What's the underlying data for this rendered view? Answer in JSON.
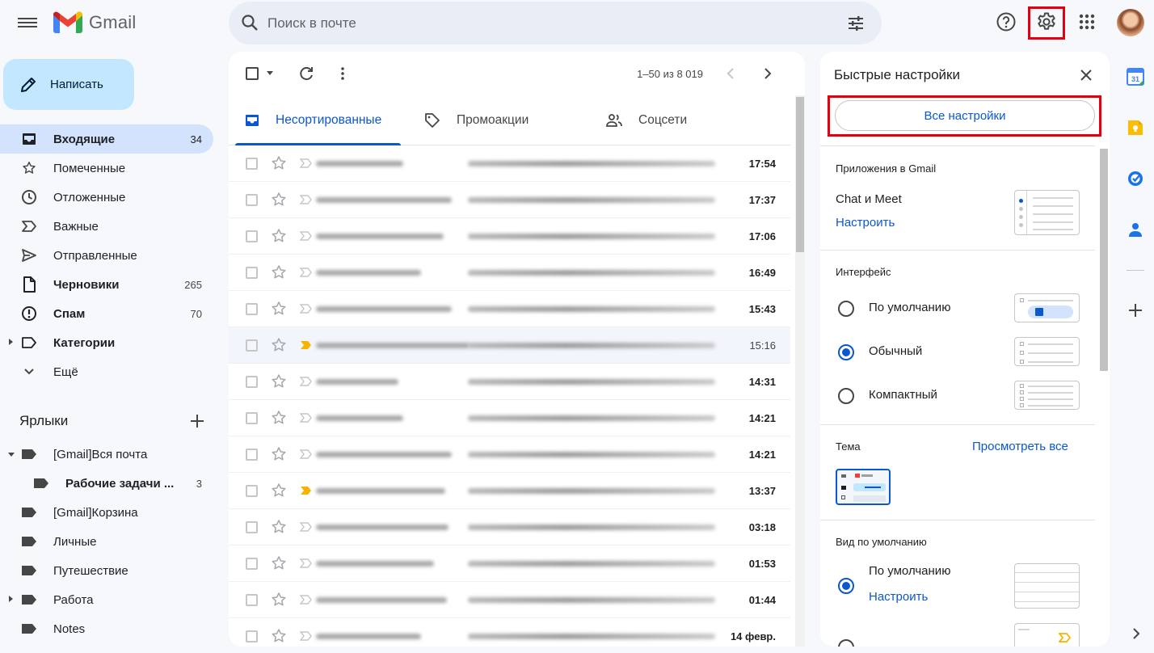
{
  "header": {
    "app_name": "Gmail",
    "search_placeholder": "Поиск в почте"
  },
  "sidebar": {
    "compose_label": "Написать",
    "items": [
      {
        "label": "Входящие",
        "count": "34"
      },
      {
        "label": "Помеченные",
        "count": ""
      },
      {
        "label": "Отложенные",
        "count": ""
      },
      {
        "label": "Важные",
        "count": ""
      },
      {
        "label": "Отправленные",
        "count": ""
      },
      {
        "label": "Черновики",
        "count": "265"
      },
      {
        "label": "Спам",
        "count": "70"
      },
      {
        "label": "Категории",
        "count": ""
      },
      {
        "label": "Ещё",
        "count": ""
      }
    ],
    "labels_title": "Ярлыки",
    "labels": [
      {
        "label": "[Gmail]Вся почта",
        "count": ""
      },
      {
        "label": "Рабочие задачи ...",
        "count": "3"
      },
      {
        "label": "[Gmail]Корзина",
        "count": ""
      },
      {
        "label": "Личные",
        "count": ""
      },
      {
        "label": "Путешествие",
        "count": ""
      },
      {
        "label": "Работа",
        "count": ""
      },
      {
        "label": "Notes",
        "count": ""
      }
    ]
  },
  "toolbar": {
    "pagination": "1–50 из 8 019"
  },
  "tabs": [
    {
      "label": "Несортированные",
      "active": true
    },
    {
      "label": "Промоакции",
      "active": false
    },
    {
      "label": "Соцсети",
      "active": false
    }
  ],
  "emails": [
    {
      "time": "17:54",
      "unread": true,
      "important": false
    },
    {
      "time": "17:37",
      "unread": true,
      "important": false
    },
    {
      "time": "17:06",
      "unread": true,
      "important": false
    },
    {
      "time": "16:49",
      "unread": true,
      "important": false
    },
    {
      "time": "15:43",
      "unread": true,
      "important": false
    },
    {
      "time": "15:16",
      "unread": false,
      "important": true
    },
    {
      "time": "14:31",
      "unread": true,
      "important": false
    },
    {
      "time": "14:21",
      "unread": true,
      "important": false
    },
    {
      "time": "14:21",
      "unread": true,
      "important": false
    },
    {
      "time": "13:37",
      "unread": true,
      "important": true
    },
    {
      "time": "03:18",
      "unread": true,
      "important": false
    },
    {
      "time": "01:53",
      "unread": true,
      "important": false
    },
    {
      "time": "01:44",
      "unread": true,
      "important": false
    },
    {
      "time": "14 февр.",
      "unread": true,
      "important": false
    }
  ],
  "quick_settings": {
    "title": "Быстрые настройки",
    "all_settings": "Все настройки",
    "apps_heading": "Приложения в Gmail",
    "chat_meet": "Chat и Meet",
    "configure": "Настроить",
    "interface_heading": "Интерфейс",
    "density": [
      {
        "label": "По умолчанию",
        "selected": false
      },
      {
        "label": "Обычный",
        "selected": true
      },
      {
        "label": "Компактный",
        "selected": false
      }
    ],
    "theme_heading": "Тема",
    "view_all": "Просмотреть все",
    "inbox_type_heading": "Вид по умолчанию",
    "inbox_default": "По умолчанию",
    "inbox_configure": "Настроить"
  },
  "colors": {
    "accent": "#0b57d0",
    "highlight_box": "#e4000f",
    "compose_bg": "#c2e7ff",
    "active_nav_bg": "#d3e3fd",
    "important_marker": "#f4b400"
  }
}
